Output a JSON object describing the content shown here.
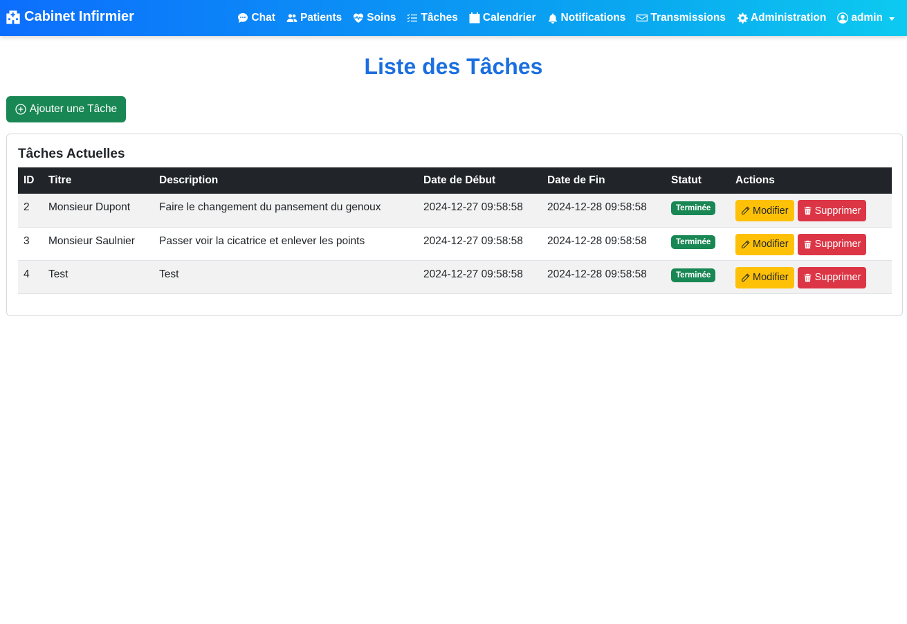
{
  "navbar": {
    "brand": "Cabinet Infirmier",
    "items": [
      {
        "label": "Chat",
        "icon": "chat-icon"
      },
      {
        "label": "Patients",
        "icon": "people-icon"
      },
      {
        "label": "Soins",
        "icon": "heart-pulse-icon"
      },
      {
        "label": "Tâches",
        "icon": "list-check-icon"
      },
      {
        "label": "Calendrier",
        "icon": "calendar-icon"
      },
      {
        "label": "Notifications",
        "icon": "bell-icon"
      },
      {
        "label": "Transmissions",
        "icon": "envelope-icon"
      },
      {
        "label": "Administration",
        "icon": "gear-icon"
      }
    ],
    "user": "admin"
  },
  "page": {
    "title": "Liste des Tâches",
    "add_button": "Ajouter une Tâche"
  },
  "card": {
    "title": "Tâches Actuelles",
    "columns": [
      "ID",
      "Titre",
      "Description",
      "Date de Début",
      "Date de Fin",
      "Statut",
      "Actions"
    ],
    "rows": [
      {
        "id": "2",
        "titre": "Monsieur Dupont",
        "description": "Faire le changement du pansement du genoux",
        "debut": "2024-12-27 09:58:58",
        "fin": "2024-12-28 09:58:58",
        "statut": "Terminée"
      },
      {
        "id": "3",
        "titre": "Monsieur Saulnier",
        "description": "Passer voir la cicatrice et enlever les points",
        "debut": "2024-12-27 09:58:58",
        "fin": "2024-12-28 09:58:58",
        "statut": "Terminée"
      },
      {
        "id": "4",
        "titre": "Test",
        "description": "Test",
        "debut": "2024-12-27 09:58:58",
        "fin": "2024-12-28 09:58:58",
        "statut": "Terminée"
      }
    ],
    "edit_label": "Modifier",
    "delete_label": "Supprimer"
  },
  "colors": {
    "navbar_start": "#0d6efd",
    "navbar_end": "#0dcaf0",
    "title": "#1b6fe0",
    "success": "#198754",
    "warning": "#ffc107",
    "danger": "#dc3545",
    "table_header": "#212529"
  }
}
